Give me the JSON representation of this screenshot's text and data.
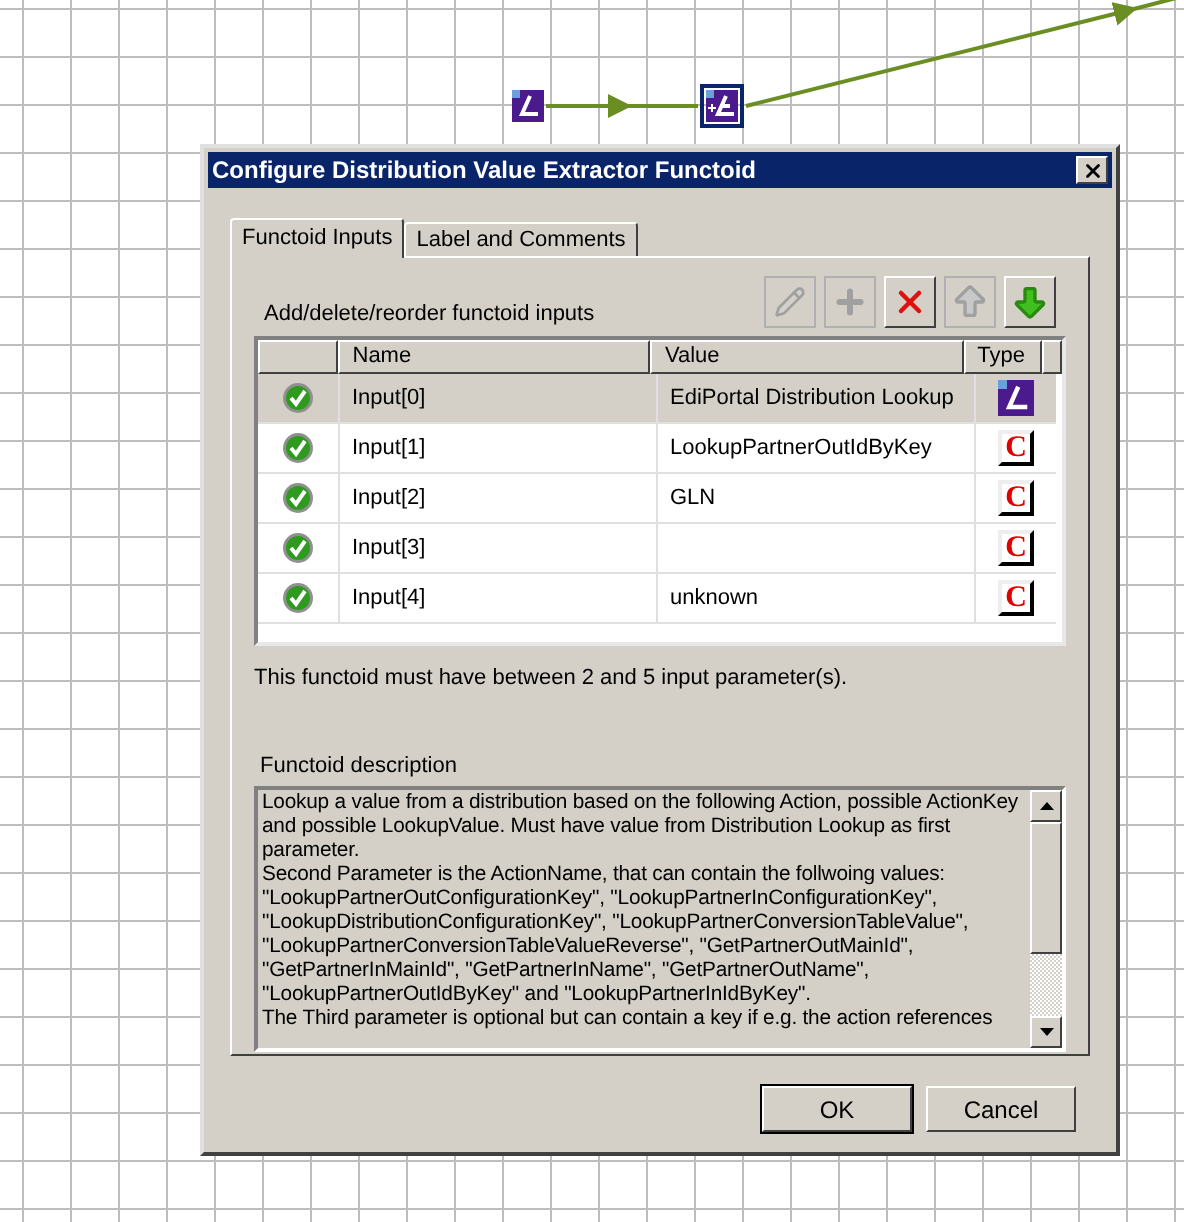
{
  "canvas": {
    "functoids": [
      {
        "kind": "source",
        "selected": false
      },
      {
        "kind": "extractor",
        "selected": true
      }
    ]
  },
  "window": {
    "title": "Configure Distribution Value Extractor Functoid"
  },
  "tabs": [
    {
      "label": "Functoid Inputs",
      "selected": true
    },
    {
      "label": "Label and Comments",
      "selected": false
    }
  ],
  "inputs_section": {
    "label": "Add/delete/reorder functoid inputs",
    "toolbar": [
      {
        "kind": "edit",
        "disabled": true
      },
      {
        "kind": "add",
        "disabled": true
      },
      {
        "kind": "delete",
        "disabled": false
      },
      {
        "kind": "move-up",
        "disabled": true
      },
      {
        "kind": "move-down",
        "disabled": false
      }
    ]
  },
  "table": {
    "columns": [
      "Name",
      "Value",
      "Type"
    ],
    "rows": [
      {
        "name": "Input[0]",
        "value": "EdiPortal Distribution Lookup",
        "type": {
          "kind": "functoid"
        },
        "selected": true
      },
      {
        "name": "Input[1]",
        "value": "LookupPartnerOutIdByKey",
        "type": {
          "kind": "constant",
          "glyph": "C"
        },
        "selected": false
      },
      {
        "name": "Input[2]",
        "value": "GLN",
        "type": {
          "kind": "constant",
          "glyph": "C"
        },
        "selected": false
      },
      {
        "name": "Input[3]",
        "type": {
          "kind": "constant",
          "glyph": "C"
        },
        "selected": false
      },
      {
        "name": "Input[4]",
        "value": "unknown",
        "type": {
          "kind": "constant",
          "glyph": "C"
        },
        "selected": false
      }
    ]
  },
  "parameter_note": "This functoid must have between 2 and 5 input parameter(s).",
  "description": {
    "label": "Functoid description",
    "paragraphs": [
      "Lookup a value from a distribution based on the following Action, possible ActionKey and possible LookupValue. Must have value from Distribution Lookup as first parameter.",
      "Second Parameter is the ActionName, that can contain the follwoing values: \"LookupPartnerOutConfigurationKey\", \"LookupPartnerInConfigurationKey\", \"LookupDistributionConfigurationKey\", \"LookupPartnerConversionTableValue\", \"LookupPartnerConversionTableValueReverse\", \"GetPartnerOutMainId\", \"GetPartnerInMainId\", \"GetPartnerInName\", \"GetPartnerOutName\", \"LookupPartnerOutIdByKey\" and \"LookupPartnerInIdByKey\".",
      "The Third parameter is optional but can contain a key if e.g. the action references"
    ]
  },
  "buttons": [
    {
      "label": "OK",
      "default": true
    },
    {
      "label": "Cancel",
      "default": false
    }
  ]
}
